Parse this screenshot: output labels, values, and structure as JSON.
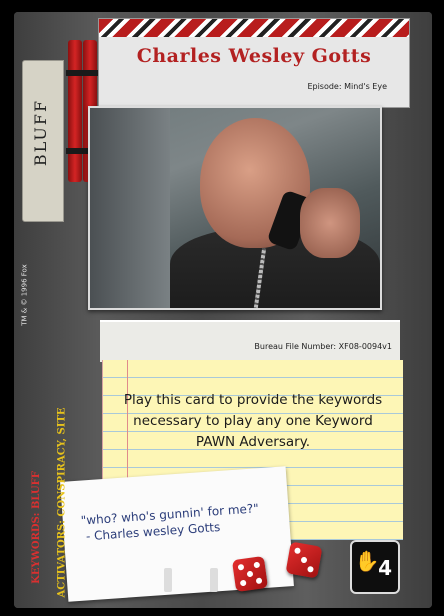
{
  "card": {
    "title": "Charles Wesley Gotts",
    "episode": "Episode: Mind's Eye",
    "card_type": "BLUFF",
    "copyright": "TM & © 1996 Fox",
    "bureau_file": "Bureau File Number: XF08-0094v1",
    "game_text": [
      "Play this card to provide the keywords",
      "necessary to play any one Keyword",
      "PAWN Adversary."
    ],
    "quote": [
      "\"who? who's gunnin' for me?\"",
      "- Charles wesley Gotts"
    ],
    "keywords": "KEYWORDS: BLUFF",
    "activators": "ACTIVATORS: CONSPIRACY, SITE",
    "cost": "4",
    "cost_icon": "red-hand-icon"
  },
  "colors": {
    "title": "#b32121",
    "keywords": "#d93030",
    "activators": "#e7c21b",
    "quote_ink": "#2b3d7a"
  }
}
